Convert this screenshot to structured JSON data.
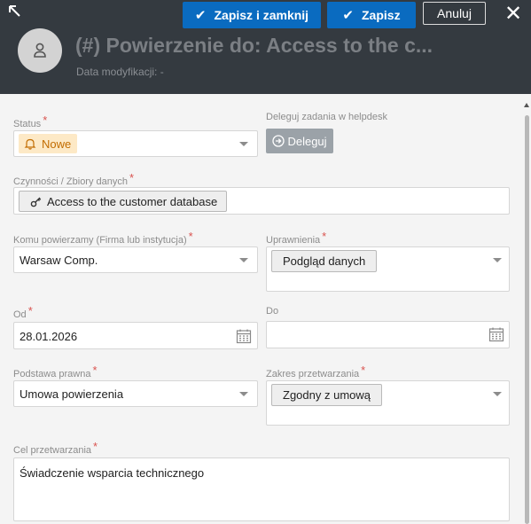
{
  "toolbar": {
    "save_close_label": "Zapisz i zamknij",
    "save_label": "Zapisz",
    "cancel_label": "Anuluj"
  },
  "header": {
    "title": "(#) Powierzenie do: Access to the c...",
    "subtitle": "Data modyfikacji: -"
  },
  "form": {
    "status": {
      "label": "Status",
      "value": "Nowe"
    },
    "delegate": {
      "label": "Deleguj zadania w helpdesk",
      "button": "Deleguj"
    },
    "activities": {
      "label": "Czynności / Zbiory danych",
      "value": "Access to the customer database"
    },
    "entrusted_to": {
      "label": "Komu powierzamy (Firma lub instytucja)",
      "value": "Warsaw Comp."
    },
    "permissions": {
      "label": "Uprawnienia",
      "value": "Podgląd danych"
    },
    "from": {
      "label": "Od",
      "value": "28.01.2026"
    },
    "to": {
      "label": "Do",
      "value": ""
    },
    "legal_basis": {
      "label": "Podstawa prawna",
      "value": "Umowa powierzenia"
    },
    "processing_scope": {
      "label": "Zakres przetwarzania",
      "value": "Zgodny z umową"
    },
    "processing_purpose": {
      "label": "Cel przetwarzania",
      "value": "Świadczenie wsparcia technicznego"
    }
  },
  "colors": {
    "header_bg": "#343a40",
    "primary": "#0a6bc0",
    "required": "#d9534f",
    "status_chip_bg": "#fde9c6",
    "status_chip_text": "#c26c00"
  }
}
